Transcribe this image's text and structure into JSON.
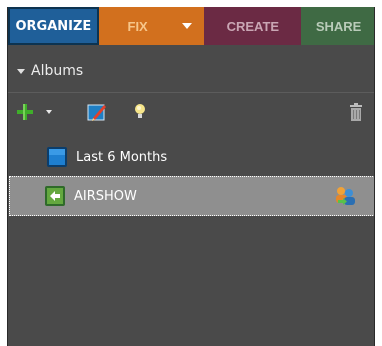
{
  "tabs": [
    {
      "label": "ORGANIZE",
      "active": true,
      "color": "#1f5f99"
    },
    {
      "label": "FIX",
      "active": false,
      "color": "#d2701e"
    },
    {
      "label": "CREATE",
      "active": false,
      "color": "#6b2a44"
    },
    {
      "label": "SHARE",
      "active": false,
      "color": "#3f6a44"
    }
  ],
  "albums_panel": {
    "header": "Albums",
    "toolbar": {
      "add_icon": "plus-icon",
      "edit_icon": "pencil-icon",
      "tip_icon": "lightbulb-icon",
      "delete_icon": "trash-icon"
    },
    "items": [
      {
        "label": "Last 6 Months",
        "icon": "smart-album-icon",
        "selected": false
      },
      {
        "label": "AIRSHOW",
        "icon": "album-icon",
        "selected": true,
        "status_icon": "shared-album-icon"
      }
    ]
  }
}
